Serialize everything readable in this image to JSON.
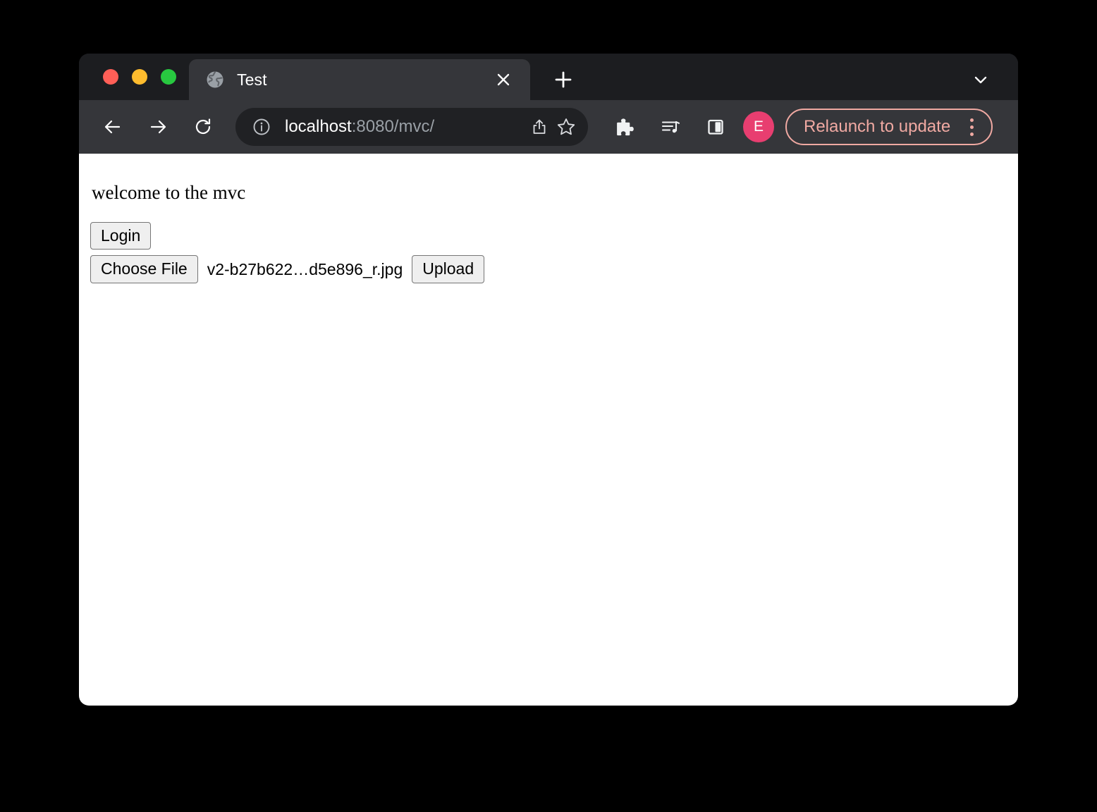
{
  "window": {
    "traffic_lights": [
      {
        "name": "close",
        "color": "#ff5f57"
      },
      {
        "name": "minimize",
        "color": "#febc2e"
      },
      {
        "name": "zoom",
        "color": "#28c840"
      }
    ]
  },
  "tab_strip": {
    "tabs": [
      {
        "title": "Test",
        "favicon": "globe-icon",
        "close_label": "✕"
      }
    ],
    "new_tab_label": "+",
    "tab_search_icon": "chevron-down-icon"
  },
  "toolbar": {
    "back_icon": "back-arrow-icon",
    "forward_icon": "forward-arrow-icon",
    "reload_icon": "reload-icon",
    "omnibox": {
      "info_icon": "info-circle-icon",
      "host": "localhost",
      "path": ":8080/mvc/",
      "share_icon": "share-icon",
      "bookmark_icon": "star-icon"
    },
    "extensions_icon": "puzzle-piece-icon",
    "media_icon": "media-playlist-icon",
    "side_panel_icon": "side-panel-icon",
    "avatar": {
      "initial": "E",
      "color": "#e83e70"
    },
    "relaunch": {
      "label": "Relaunch to update",
      "color": "#f0a9a2"
    },
    "menu_icon": "kebab-menu-icon"
  },
  "page": {
    "heading": "welcome to the mvc",
    "login_button": "Login",
    "choose_file_button": "Choose File",
    "file_name": "v2-b27b622…d5e896_r.jpg",
    "upload_button": "Upload"
  }
}
